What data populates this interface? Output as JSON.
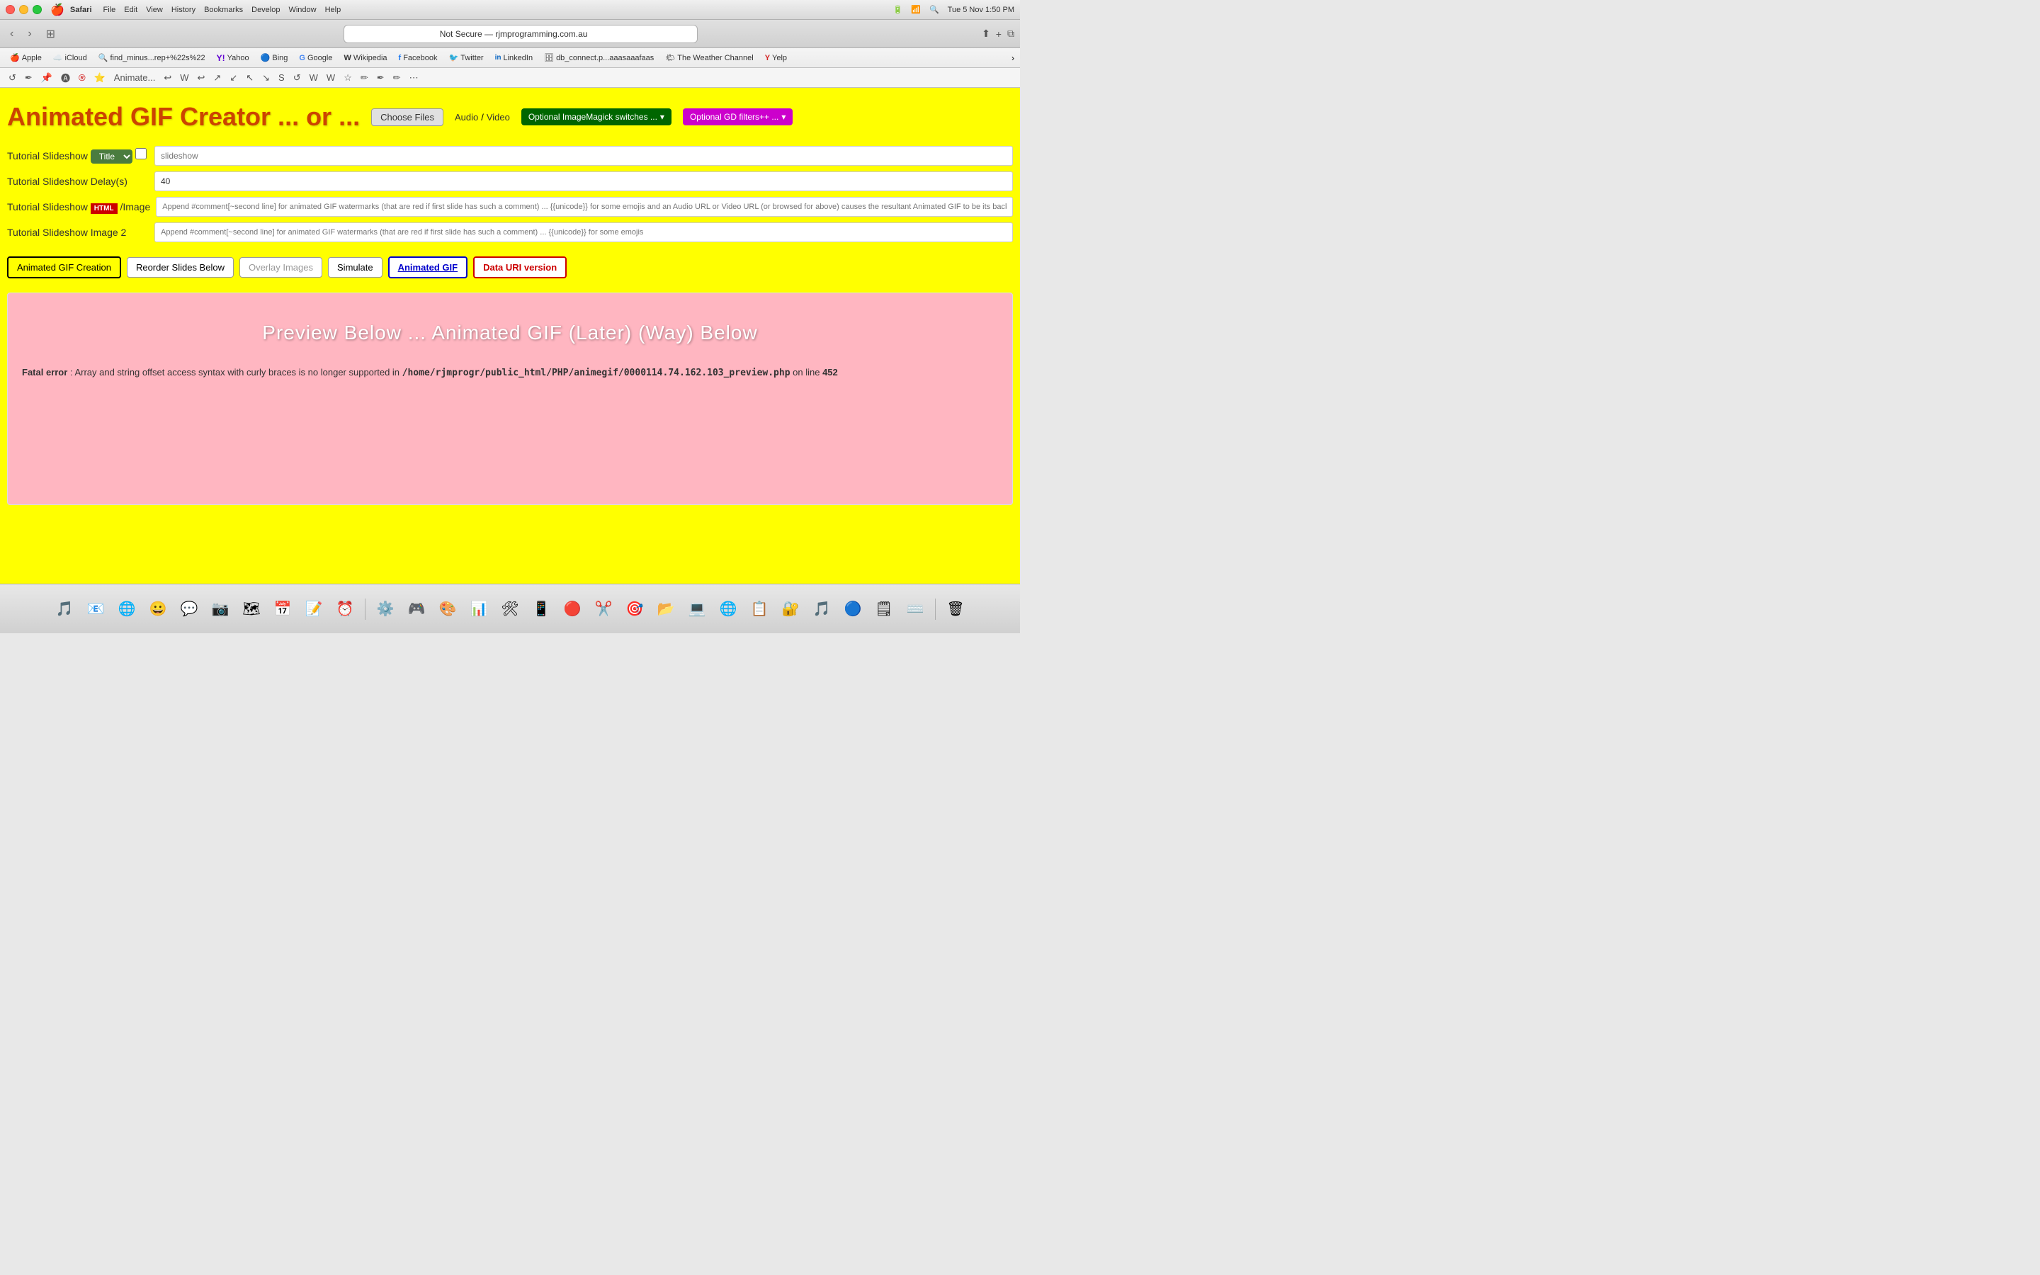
{
  "os": {
    "apple_menu": "🍎",
    "app_name": "Safari",
    "menu_items": [
      "File",
      "Edit",
      "View",
      "History",
      "Bookmarks",
      "Develop",
      "Window",
      "Help"
    ],
    "datetime": "Tue 5 Nov  1:50 PM",
    "battery_icon": "🔋"
  },
  "window": {
    "title": "Not Secure — rjmprogramming.com.au",
    "close_label": "×"
  },
  "bookmarks": [
    {
      "label": "Apple",
      "icon": "🍎"
    },
    {
      "label": "iCloud",
      "icon": "☁️"
    },
    {
      "label": "find_minus...rep+%22s%22",
      "icon": "🔍"
    },
    {
      "label": "Yahoo",
      "icon": "Y!"
    },
    {
      "label": "Bing",
      "icon": "🔵"
    },
    {
      "label": "Google",
      "icon": "G"
    },
    {
      "label": "Wikipedia",
      "icon": "W"
    },
    {
      "label": "Facebook",
      "icon": "f"
    },
    {
      "label": "Twitter",
      "icon": "🐦"
    },
    {
      "label": "LinkedIn",
      "icon": "in"
    },
    {
      "label": "db_connect.p...aaasaaafaas",
      "icon": "🗄"
    },
    {
      "label": "The Weather Channel",
      "icon": "🌤"
    },
    {
      "label": "Yelp",
      "icon": "Y"
    }
  ],
  "app": {
    "title": "Animated GIF Creator ... or ...",
    "choose_files_label": "Choose Files",
    "audio_label": "Audio",
    "separator": "/",
    "video_label": "Video",
    "imagemagick_label": "Optional ImageMagick switches ...",
    "gd_filters_label": "Optional GD filters++ ...",
    "form": {
      "tutorial_slideshow_label": "Tutorial Slideshow",
      "title_dropdown_label": "Title",
      "slideshow_placeholder": "slideshow",
      "delay_label": "Tutorial Slideshow Delay(s)",
      "delay_value": "40",
      "image_label": "Tutorial Slideshow",
      "html_badge": "HTML",
      "image_suffix": "/Image",
      "image_placeholder": "Append #comment[~second line] for animated GIF watermarks (that are red if first slide has such a comment) ... {{unicode}} for some emojis and an Audio URL or Video URL (or browsed for above) causes the resultant Animated GIF to be its background image",
      "image2_label": "Tutorial Slideshow Image 2",
      "image2_placeholder": "Append #comment[~second line] for animated GIF watermarks (that are red if first slide has such a comment) ... {{unicode}} for some emojis"
    },
    "buttons": {
      "animated_gif_creation": "Animated GIF Creation",
      "reorder_slides": "Reorder Slides Below",
      "overlay_images": "Overlay Images",
      "simulate": "Simulate",
      "animated_gif": "Animated GIF",
      "data_uri": "Data URI version"
    },
    "preview": {
      "title": "Preview Below ... Animated GIF (Later) (Way) Below",
      "error_bold": "Fatal error",
      "error_text": ": Array and string offset access syntax with curly braces is no longer supported in ",
      "error_path": "/home/rjmprogr/public_html/PHP/animegif/0000114.74.162.103_preview.php",
      "error_line_text": " on line ",
      "error_line_num": "452"
    }
  },
  "dock": {
    "items": [
      {
        "icon": "🎵",
        "label": "Music"
      },
      {
        "icon": "📧",
        "label": "Mail"
      },
      {
        "icon": "🌐",
        "label": "Safari"
      },
      {
        "icon": "🗂",
        "label": "Finder"
      },
      {
        "icon": "💬",
        "label": "Messages"
      },
      {
        "icon": "🗓",
        "label": "Calendar"
      },
      {
        "icon": "📷",
        "label": "Photos"
      },
      {
        "icon": "📝",
        "label": "Notes"
      },
      {
        "icon": "⚙️",
        "label": "Settings"
      },
      {
        "icon": "🔧",
        "label": "Tools"
      },
      {
        "icon": "🎮",
        "label": "Games"
      },
      {
        "icon": "📱",
        "label": "iPhone"
      },
      {
        "icon": "🖥",
        "label": "Display"
      },
      {
        "icon": "📊",
        "label": "Stats"
      },
      {
        "icon": "🔒",
        "label": "Security"
      },
      {
        "icon": "📂",
        "label": "Files"
      },
      {
        "icon": "🎯",
        "label": "Target"
      },
      {
        "icon": "🎨",
        "label": "Art"
      }
    ]
  }
}
